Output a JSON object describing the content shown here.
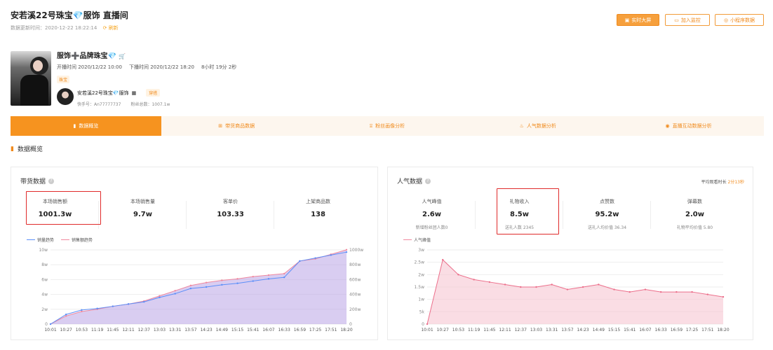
{
  "header": {
    "title": "安若溪22号珠宝💎服饰 直播间",
    "updated_label": "数据更新时间：2020-12-22 18:22:14",
    "refresh_label": "刷新",
    "buttons": {
      "realtime": "实时大屏",
      "monitor": "加入监控",
      "miniprogram": "小程序数据"
    }
  },
  "room": {
    "name": "服饰➕品牌珠宝💎",
    "start": "开播时间 2020/12/22 10:00",
    "end": "下播时间 2020/12/22 18:20",
    "duration": "8小时 19分 2秒",
    "tag": "珠宝",
    "anchor_name": "安若溪22号珠宝💎服饰",
    "anchor_tag": "穿搭",
    "kuaishou_id": "快手号：An77777737",
    "fans": "粉丝总数：1007.1w"
  },
  "tabs": [
    {
      "label": "数据概览",
      "icon": "bar-chart-icon",
      "active": true
    },
    {
      "label": "带货商品数据",
      "icon": "basket-icon",
      "active": false
    },
    {
      "label": "粉丝画像分析",
      "icon": "portrait-icon",
      "active": false
    },
    {
      "label": "人气数据分析",
      "icon": "flame-icon",
      "active": false
    },
    {
      "label": "直播互动数据分析",
      "icon": "interaction-icon",
      "active": false
    }
  ],
  "section_title": "数据概览",
  "sales": {
    "title": "带货数据",
    "metrics": [
      {
        "label": "本场销售额",
        "value": "1001.3w"
      },
      {
        "label": "本场销售量",
        "value": "9.7w"
      },
      {
        "label": "客单价",
        "value": "103.33"
      },
      {
        "label": "上架商品数",
        "value": "138"
      }
    ],
    "legend": [
      "销量趋势",
      "销售额趋势"
    ]
  },
  "popularity": {
    "title": "人气数据",
    "avg_label": "平均观看时长",
    "avg_value": "2分13秒",
    "metrics": [
      {
        "label": "人气峰值",
        "value": "2.6w",
        "sub": "新增粉丝团人数0"
      },
      {
        "label": "礼物收入",
        "value": "8.5w",
        "sub": "送礼人数 2345"
      },
      {
        "label": "点赞数",
        "value": "95.2w",
        "sub": "送礼人均价值 36.34"
      },
      {
        "label": "弹幕数",
        "value": "2.0w",
        "sub": "礼物平均价值 5.80"
      }
    ],
    "legend": [
      "人气峰值"
    ]
  },
  "chart_data": [
    {
      "type": "line",
      "x": [
        "10:01",
        "10:27",
        "10:53",
        "11:19",
        "11:45",
        "12:11",
        "12:37",
        "13:03",
        "13:31",
        "13:57",
        "14:23",
        "14:49",
        "15:15",
        "15:41",
        "16:07",
        "16:33",
        "16:59",
        "17:25",
        "17:51",
        "18:20"
      ],
      "series": [
        {
          "name": "销量趋势",
          "axis": "left",
          "unit": "w",
          "values": [
            0,
            1.3,
            1.9,
            2.1,
            2.4,
            2.7,
            3.0,
            3.6,
            4.1,
            4.8,
            5.0,
            5.3,
            5.5,
            5.8,
            6.1,
            6.3,
            8.5,
            8.9,
            9.3,
            9.7
          ]
        },
        {
          "name": "销售额趋势",
          "axis": "right",
          "unit": "w",
          "values": [
            0,
            110,
            170,
            200,
            240,
            270,
            310,
            380,
            450,
            520,
            560,
            590,
            610,
            640,
            660,
            680,
            850,
            880,
            940,
            1001.3
          ]
        }
      ],
      "yleft_ticks": [
        "0",
        "2w",
        "4w",
        "6w",
        "8w",
        "10w"
      ],
      "yright_ticks": [
        "0",
        "200w",
        "400w",
        "600w",
        "800w",
        "1000w"
      ],
      "ylim_left": [
        0,
        10
      ],
      "ylim_right": [
        0,
        1000
      ]
    },
    {
      "type": "area",
      "x": [
        "10:01",
        "10:27",
        "10:53",
        "11:19",
        "11:45",
        "12:11",
        "12:37",
        "13:03",
        "13:31",
        "13:57",
        "14:23",
        "14:49",
        "15:15",
        "15:41",
        "16:07",
        "16:33",
        "16:59",
        "17:25",
        "17:51",
        "18:20"
      ],
      "series": [
        {
          "name": "人气峰值",
          "unit": "w",
          "values": [
            0,
            2.6,
            2.0,
            1.8,
            1.7,
            1.6,
            1.5,
            1.5,
            1.6,
            1.4,
            1.5,
            1.6,
            1.4,
            1.3,
            1.4,
            1.3,
            1.3,
            1.3,
            1.2,
            1.1
          ]
        }
      ],
      "y_ticks": [
        "0",
        "5k",
        "1w",
        "1.5w",
        "2w",
        "2.5w",
        "3w"
      ],
      "ylim": [
        0,
        3
      ]
    }
  ]
}
